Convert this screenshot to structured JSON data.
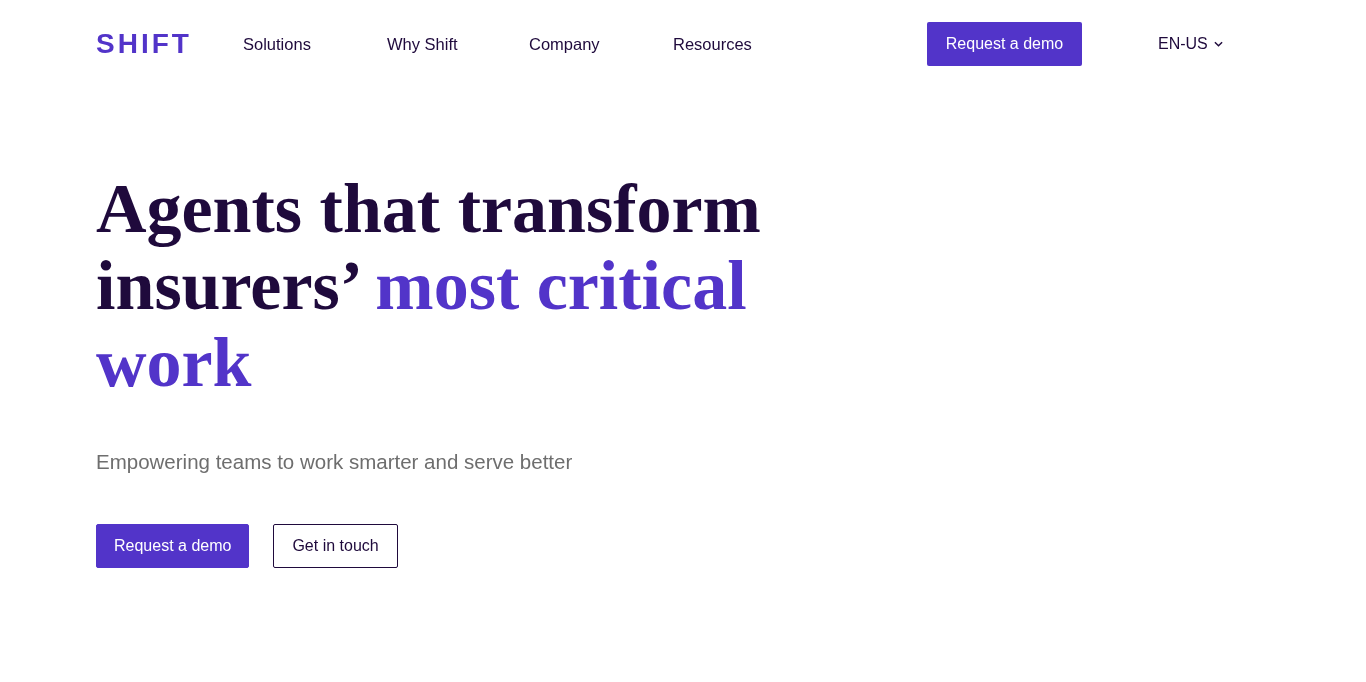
{
  "header": {
    "logo": "SHIFT",
    "nav": [
      "Solutions",
      "Why Shift",
      "Company",
      "Resources"
    ],
    "cta": "Request a demo",
    "language": {
      "label": "EN-US",
      "expanded": false
    }
  },
  "hero": {
    "headline": [
      {
        "text": "Agents that transform insurers’",
        "accent": false
      },
      {
        "text": "most critical work",
        "accent": true
      }
    ],
    "subtitle": "Empowering teams to work smarter and serve better",
    "buttons": [
      {
        "label": "Request a demo",
        "kind": "primary"
      },
      {
        "label": "Get in touch",
        "kind": "outline"
      }
    ]
  }
}
